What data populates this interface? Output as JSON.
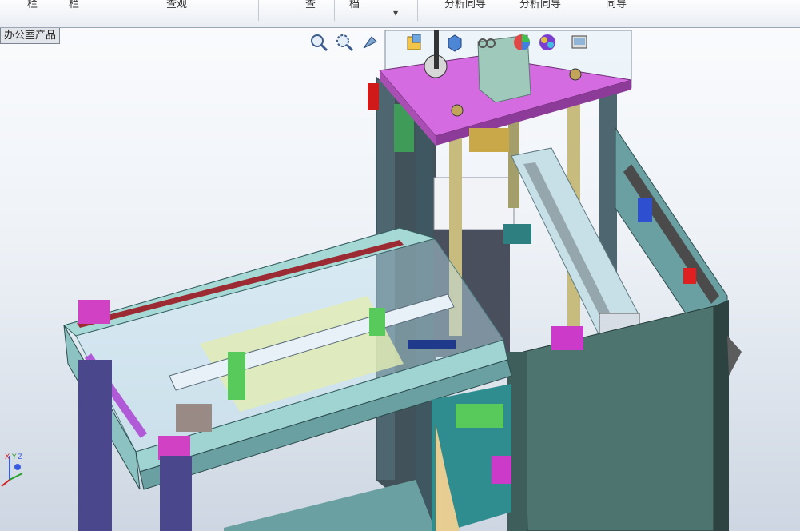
{
  "ribbon": {
    "items": [
      "栏",
      "栏",
      "查观",
      "查",
      "档",
      "分析同导",
      "分析同导",
      "同导"
    ]
  },
  "feature_tree": {
    "label": "办公室产品"
  },
  "heads_up_toolbar": {
    "icons": [
      "zoom-to-fit-icon",
      "zoom-to-area-icon",
      "previous-view-icon",
      "section-view-icon",
      "view-orientation-icon",
      "display-style-icon",
      "hide-show-items-icon",
      "edit-appearance-icon",
      "apply-scene-icon",
      "view-settings-icon"
    ]
  },
  "triad": {
    "axes": [
      "X",
      "Y",
      "Z"
    ]
  },
  "colors": {
    "frame": "#a6d9d6",
    "panel": "#4e7470",
    "magenta": "#d56be0",
    "rail_dark": "#474660",
    "purple_post": "#4a478c",
    "glass": "#bfe3f0"
  }
}
